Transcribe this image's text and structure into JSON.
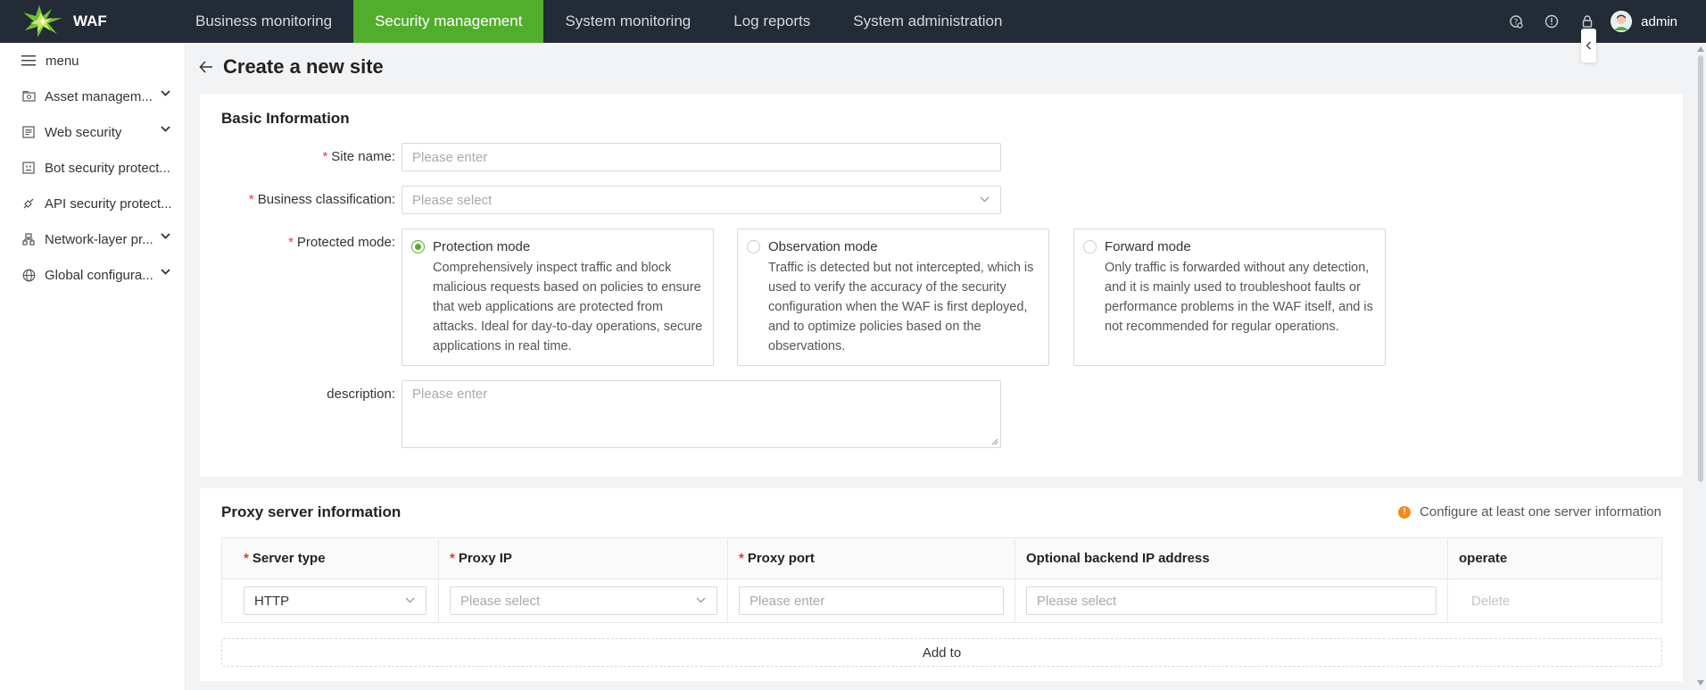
{
  "app": {
    "logo_text": "WAF"
  },
  "nav": {
    "items": [
      {
        "label": "Business monitoring"
      },
      {
        "label": "Security management"
      },
      {
        "label": "System monitoring"
      },
      {
        "label": "Log reports"
      },
      {
        "label": "System administration"
      }
    ],
    "active": "Security management"
  },
  "user": {
    "name": "admin"
  },
  "sidebar": {
    "menu_label": "menu",
    "items": [
      {
        "label": "Asset managem...",
        "icon": "asset-icon",
        "expandable": true
      },
      {
        "label": "Web security",
        "icon": "web-security-icon",
        "expandable": true
      },
      {
        "label": "Bot security protect...",
        "icon": "bot-icon",
        "expandable": false
      },
      {
        "label": "API security protect...",
        "icon": "api-icon",
        "expandable": false
      },
      {
        "label": "Network-layer pr...",
        "icon": "network-icon",
        "expandable": true
      },
      {
        "label": "Global configura...",
        "icon": "globe-icon",
        "expandable": true
      }
    ]
  },
  "page": {
    "title": "Create a new site"
  },
  "basic_info": {
    "title": "Basic Information",
    "site_name": {
      "label": "Site name",
      "placeholder": "Please enter",
      "value": ""
    },
    "business_classification": {
      "label": "Business classification",
      "placeholder": "Please select",
      "value": ""
    },
    "protected_mode": {
      "label": "Protected mode",
      "selected": "Protection mode",
      "options": [
        {
          "title": "Protection mode",
          "desc": "Comprehensively inspect traffic and block malicious requests based on policies to ensure that web applications are protected from attacks. Ideal for day-to-day operations, secure applications in real time."
        },
        {
          "title": "Observation mode",
          "desc": "Traffic is detected but not intercepted, which is used to verify the accuracy of the security configuration when the WAF is first deployed, and to optimize policies based on the observations."
        },
        {
          "title": "Forward mode",
          "desc": "Only traffic is forwarded without any detection, and it is mainly used to troubleshoot faults or performance problems in the WAF itself, and is not recommended for regular operations."
        }
      ]
    },
    "description": {
      "label": "description",
      "placeholder": "Please enter"
    }
  },
  "proxy": {
    "title": "Proxy server information",
    "hint": "Configure at least one server information",
    "columns": [
      "Server type",
      "Proxy IP",
      "Proxy port",
      "Optional backend IP address",
      "operate"
    ],
    "rows": [
      {
        "server_type": "HTTP",
        "proxy_ip_placeholder": "Please select",
        "proxy_port_placeholder": "Please enter",
        "backend_ip_placeholder": "Please select",
        "action": "Delete"
      }
    ],
    "add_label": "Add to"
  },
  "colors": {
    "accent": "#52ad2c",
    "topbar": "#232b36",
    "required": "#e53935",
    "hint": "#f28b1c"
  }
}
